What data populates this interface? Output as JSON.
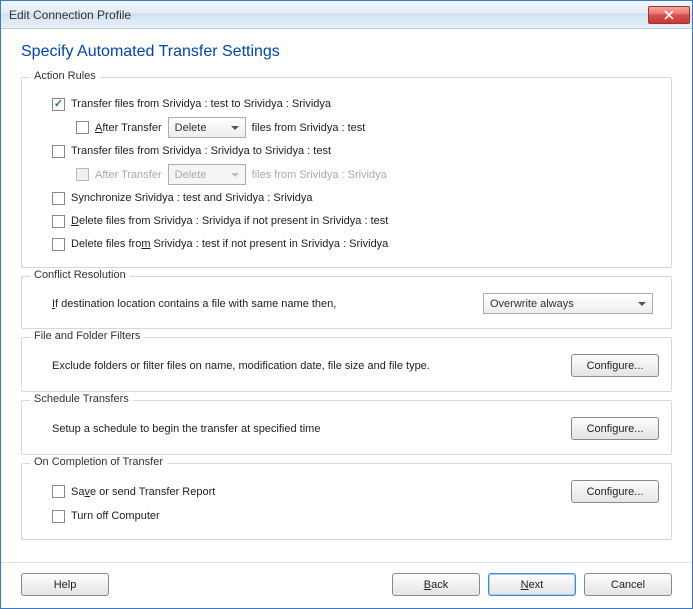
{
  "window": {
    "title": "Edit Connection Profile"
  },
  "heading": "Specify Automated Transfer Settings",
  "actionRules": {
    "legend": "Action Rules",
    "rule1": {
      "checked": true,
      "label": "Transfer files from Srividya : test to Srividya : Srividya"
    },
    "rule1After": {
      "checked": false,
      "prefix": "After Transfer",
      "select": "Delete",
      "suffix": "files from Srividya : test"
    },
    "rule2": {
      "checked": false,
      "label": "Transfer files from Srividya : Srividya to Srividya : test"
    },
    "rule2After": {
      "checked": false,
      "prefix": "After Transfer",
      "select": "Delete",
      "suffix": "files from Srividya : Srividya"
    },
    "sync": {
      "checked": false,
      "label": "Synchronize Srividya : test and Srividya : Srividya"
    },
    "del1": {
      "checked": false,
      "label": "Delete files from Srividya : Srividya if not present in Srividya : test"
    },
    "del2": {
      "checked": false,
      "label": "Delete files from Srividya : test if not present in Srividya : Srividya"
    }
  },
  "conflict": {
    "legend": "Conflict Resolution",
    "label": "If destination location contains a file with same name then,",
    "select": "Overwrite always"
  },
  "filters": {
    "legend": "File and Folder Filters",
    "label": "Exclude folders or filter files on name, modification date, file size and file type.",
    "button": "Configure..."
  },
  "schedule": {
    "legend": "Schedule Transfers",
    "label": "Setup a schedule to begin the transfer at specified time",
    "button": "Configure..."
  },
  "completion": {
    "legend": "On Completion of Transfer",
    "save": {
      "checked": false,
      "label": "Save or send Transfer Report"
    },
    "button": "Configure...",
    "turnOff": {
      "checked": false,
      "label": "Turn off Computer"
    }
  },
  "footer": {
    "help": "Help",
    "back": "Back",
    "next": "Next",
    "cancel": "Cancel"
  }
}
